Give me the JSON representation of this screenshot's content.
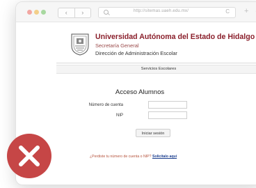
{
  "browser": {
    "nav_back": "‹",
    "nav_forward": "›",
    "url": "http://sitemas.uaeh.edu.mx/",
    "reload": "C",
    "new_tab": "+",
    "overflow": "⊙"
  },
  "header": {
    "university": "Universidad Autónoma del Estado de Hidalgo",
    "secretaria": "Secretaría General",
    "direccion": "Dirección de Administración Escolar"
  },
  "services_bar": {
    "label": "Servicios Escolares"
  },
  "login": {
    "title": "Acceso Alumnos",
    "account_label": "Número de cuenta",
    "account_value": "",
    "nip_label": "NIP",
    "nip_value": "",
    "submit_label": "Iniciar sesión"
  },
  "footer": {
    "forgot_prefix": "¿Perdiste tu número de cuenta o NIP?",
    "forgot_link": "Solicítalo aquí"
  },
  "colors": {
    "university_red": "#8a1f2b",
    "error_red": "#c64646",
    "link_blue": "#1c3f8f"
  },
  "icons": {
    "error": "close-x-icon",
    "seal": "university-seal-icon"
  }
}
